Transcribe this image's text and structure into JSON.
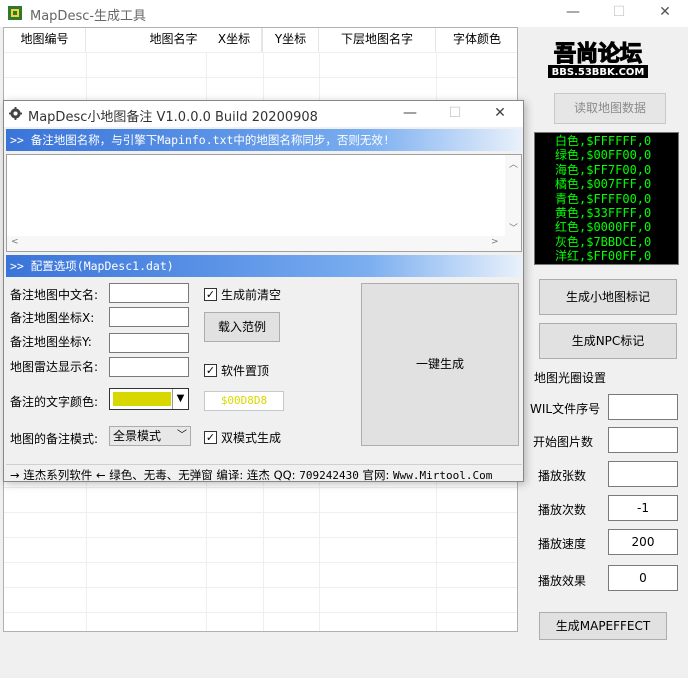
{
  "main_window": {
    "title": "MapDesc-生成工具",
    "minimize": "—",
    "maximize": "☐",
    "close": "✕"
  },
  "grid": {
    "columns": [
      "地图编号",
      "地图名字",
      "X坐标",
      "Y坐标",
      "下层地图名字",
      "字体颜色"
    ]
  },
  "right_panel": {
    "logo_text": "吾尚论坛",
    "logo_url": "BBS.53BBK.COM",
    "read_button": "读取地图数据",
    "color_lines": [
      "白色,$FFFFFF,0",
      "绿色,$00FF00,0",
      "海色,$FF7F00,0",
      "橘色,$007FFF,0",
      "青色,$FFFF00,0",
      "黄色,$33FFFF,0",
      "红色,$0000FF,0",
      "灰色,$7BBDCE,0",
      "洋红,$FF00FF,0"
    ],
    "gen_minimap_button": "生成小地图标记",
    "gen_npc_button": "生成NPC标记",
    "halo_section": "地图光圈设置",
    "fields": [
      {
        "label": "WIL文件序号",
        "value": ""
      },
      {
        "label": "开始图片数",
        "value": ""
      },
      {
        "label": "播放张数",
        "value": ""
      },
      {
        "label": "播放次数",
        "value": "-1"
      },
      {
        "label": "播放速度",
        "value": "200"
      },
      {
        "label": "播放效果",
        "value": "0"
      }
    ],
    "gen_effect_button": "生成MAPEFFECT"
  },
  "dialog": {
    "title": "MapDesc小地图备注 V1.0.0.0 Build 20200908",
    "minimize": "—",
    "maximize": "☐",
    "close": "✕",
    "notice_bar": ">> 备注地图名称，与引擎下Mapinfo.txt中的地图名称同步，否则无效!",
    "config_bar": ">> 配置选项(MapDesc1.dat)",
    "labels": {
      "cn_name": "备注地图中文名:",
      "coord_x": "备注地图坐标X:",
      "coord_y": "备注地图坐标Y:",
      "radar_name": "地图雷达显示名:",
      "text_color": "备注的文字颜色:",
      "mode": "地图的备注模式:"
    },
    "clear_before": "生成前清空",
    "load_sample": "载入范例",
    "topmost": "软件置顶",
    "dual_mode": "双模式生成",
    "one_click": "一键生成",
    "color_hex": "$00D8D8",
    "mode_value": "全景模式",
    "status": {
      "part1": "→ 连杰系列软件 ← 绿色、无毒、无弹窗 编译: 连杰 QQ: ",
      "qq": "709242430",
      "part2": " 官网: ",
      "site": "Www.Mirtool.Com"
    }
  },
  "colors": {
    "bar_blue": "#3a74d8",
    "terminal_green": "#00ff00",
    "swatch_yellow": "#d8d800"
  }
}
